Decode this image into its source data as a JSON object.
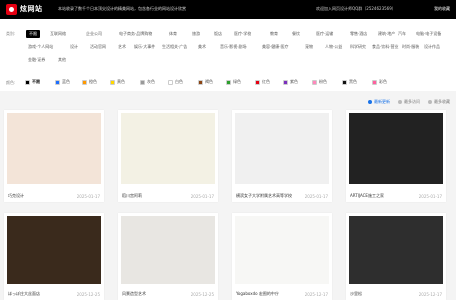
{
  "header": {
    "logo": "炫网站",
    "slogan": "本站收录了数千个日本顶尖设计的精美网站，包含各行业的网站设计欣赏",
    "contact": "欢迎加入网页设计师QQ群（2524623569）",
    "login": "我的收藏"
  },
  "filters": {
    "category_label": "类别:",
    "categories_row1": [
      "不限",
      "互联网络",
      "企业公司",
      "电子商务·品牌购物",
      "体育",
      "旅游",
      "饭店",
      "医疗·学校",
      "教育",
      "餐饮",
      "医疗·运输",
      "零售·酒店",
      "建筑·地产",
      "汽车",
      "电脑·电子设备"
    ],
    "categories_row2": [
      "游戏·个人网站",
      "设计",
      "活动官网",
      "艺术",
      "娱乐·大事件",
      "生活相关·广告",
      "美术",
      "音乐·影视·剧场",
      "美容·健康·医疗",
      "宠物",
      "人物·公益",
      "科学研究",
      "食品·饮料·营业",
      "时尚·服装",
      "设计作品"
    ],
    "categories_row3": [
      "金融·证券",
      "其他"
    ],
    "color_label": "颜色:",
    "colors": [
      {
        "name": "不限",
        "color": "#000000"
      },
      {
        "name": "蓝色",
        "color": "#1e6fff"
      },
      {
        "name": "橙色",
        "color": "#ff9900"
      },
      {
        "name": "黄色",
        "color": "#ffd800"
      },
      {
        "name": "灰色",
        "color": "#999999"
      },
      {
        "name": "白色",
        "color": "#ffffff"
      },
      {
        "name": "褐色",
        "color": "#8b4513"
      },
      {
        "name": "绿色",
        "color": "#2ca02c"
      },
      {
        "name": "红色",
        "color": "#e60012"
      },
      {
        "name": "紫色",
        "color": "#7b2fbe"
      },
      {
        "name": "粉色",
        "color": "#ff88bb"
      },
      {
        "name": "黑色",
        "color": "#111111"
      },
      {
        "name": "彩色",
        "color": "#ff5f9e"
      }
    ]
  },
  "sort": {
    "options": [
      "最新更新",
      "最多访问",
      "最多收藏"
    ]
  },
  "cards": [
    {
      "title": "巧克设计",
      "date": "2025-01-17",
      "bg": "#f3e4d8"
    },
    {
      "title": "稻川宫阿莉",
      "date": "2025-01-17",
      "bg": "#f3f1e4"
    },
    {
      "title": "横滨女子大学附属艺术高等学校",
      "date": "2025-01-17",
      "bg": "#f0f0f0"
    },
    {
      "title": "ARTIJACE施工之家",
      "date": "2025-01-17",
      "bg": "#222222"
    },
    {
      "title": "ほっぽ庄大丝面店",
      "date": "2025-12-25",
      "bg": "#3a2a1c"
    },
    {
      "title": "风景造型艺术",
      "date": "2025-12-25",
      "bg": "#e8e6e2"
    },
    {
      "title": "Yogaboxdo 宏图的中庁",
      "date": "2025-12-17",
      "bg": "#f7f7f5"
    },
    {
      "title": "沙里松",
      "date": "2025-12-17",
      "bg": "#2e2e2e"
    }
  ]
}
